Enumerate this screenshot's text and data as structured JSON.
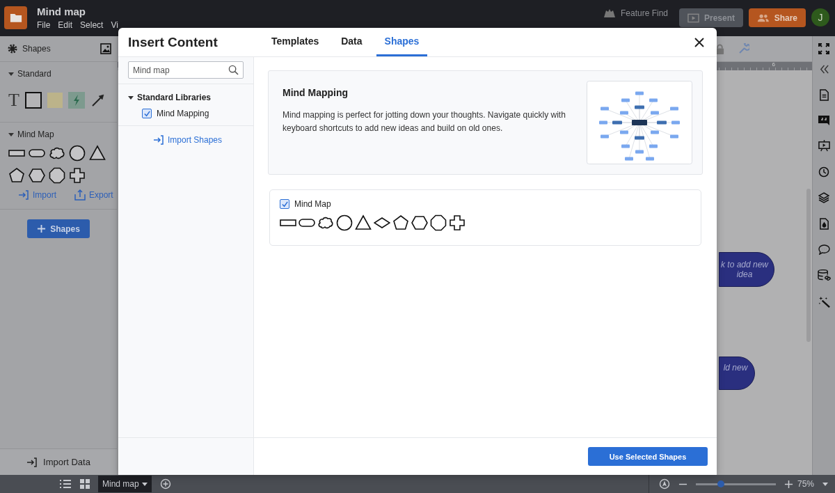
{
  "document": {
    "title": "Mind map",
    "menu": [
      "File",
      "Edit",
      "Select",
      "Vi"
    ]
  },
  "top_actions": {
    "feature_find": "Feature Find",
    "present": "Present",
    "share": "Share",
    "avatar": "J"
  },
  "shapes_panel": {
    "title": "Shapes",
    "text_tool": "T",
    "sections": [
      {
        "title": "Standard",
        "expanded": true
      },
      {
        "title": "Mind Map",
        "expanded": true
      }
    ],
    "import": "Import",
    "export": "Export",
    "add_button": "Shapes",
    "import_data": "Import Data"
  },
  "canvas": {
    "ruler_label": "6",
    "nodes": [
      "k to add new idea",
      "ld new"
    ]
  },
  "page_bar": {
    "page": "Mind map",
    "zoom": {
      "level": 0.31,
      "reading": "75%"
    }
  },
  "dialog": {
    "title": "Insert Content",
    "tabs": [
      {
        "label": "Templates",
        "selected": false
      },
      {
        "label": "Data",
        "selected": false
      },
      {
        "label": "Shapes",
        "selected": true
      }
    ],
    "search": {
      "value": "Mind map"
    },
    "libraries": [
      {
        "label": "Standard Libraries",
        "expanded": true,
        "children": [
          {
            "label": "Mind Mapping",
            "checked": true
          }
        ]
      }
    ],
    "import_shapes": "Import Shapes",
    "library": {
      "title": "Mind Mapping",
      "description": "Mind mapping is perfect for jotting down your thoughts. Navigate quickly with keyboard shortcuts to add new ideas and build on old ones."
    },
    "shape_sets": [
      {
        "label": "Mind Map",
        "checked": true
      }
    ],
    "primary_button": "Use Selected Shapes"
  }
}
